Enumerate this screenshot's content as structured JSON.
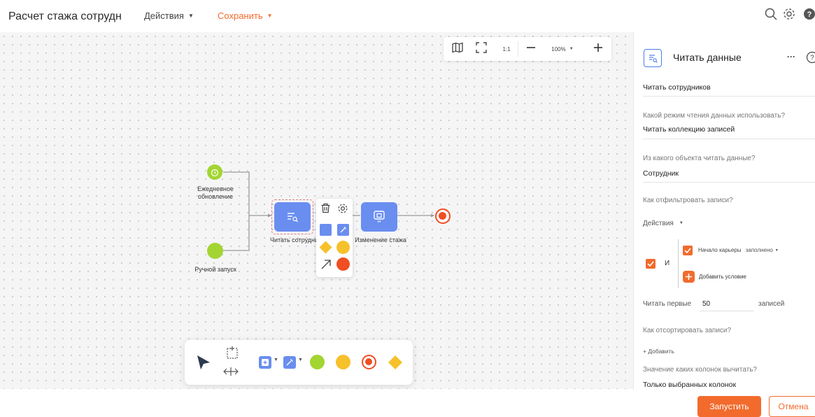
{
  "header": {
    "title": "Расчет стажа сотрудн",
    "actions_menu": "Действия",
    "save_menu": "Сохранить"
  },
  "zoombar": {
    "one_to_one": "1:1",
    "zoom_level": "100%"
  },
  "diagram": {
    "nodes": {
      "daily_update": "Ежедневное обновление",
      "manual_start": "Ручной запуск",
      "read_employees": "Читать сотрудник",
      "change_tenure": "Изменение стажа"
    }
  },
  "panel": {
    "title": "Читать данные",
    "more": "···",
    "name_value": "Читать сотрудников",
    "read_mode_question": "Какой режим чтения данных использовать?",
    "read_mode_value": "Читать коллекцию записей",
    "object_question": "Из какого объекта читать данные?",
    "object_value": "Сотрудник",
    "filter_question": "Как отфильтровать записи?",
    "actions_label": "Действия",
    "logic_and": "И",
    "condition_field": "Начало карьеры",
    "condition_op": "заполнено",
    "add_condition": "Добавить условие",
    "read_first_label": "Читать первые",
    "read_first_value": "50",
    "records_label": "записей",
    "sort_question": "Как отсортировать записи?",
    "add_sort": "+ Добавить",
    "columns_question": "Значение каких колонок вычитать?",
    "columns_value": "Только выбранных колонок"
  },
  "footer": {
    "run_button": "Запустить",
    "cancel_button": "Отмена"
  },
  "colors": {
    "accent": "#f26b2d",
    "task_blue": "#6a8ef0",
    "start_green": "#a3d532",
    "gateway_yellow": "#f6c12a",
    "end_red": "#f04e23"
  }
}
